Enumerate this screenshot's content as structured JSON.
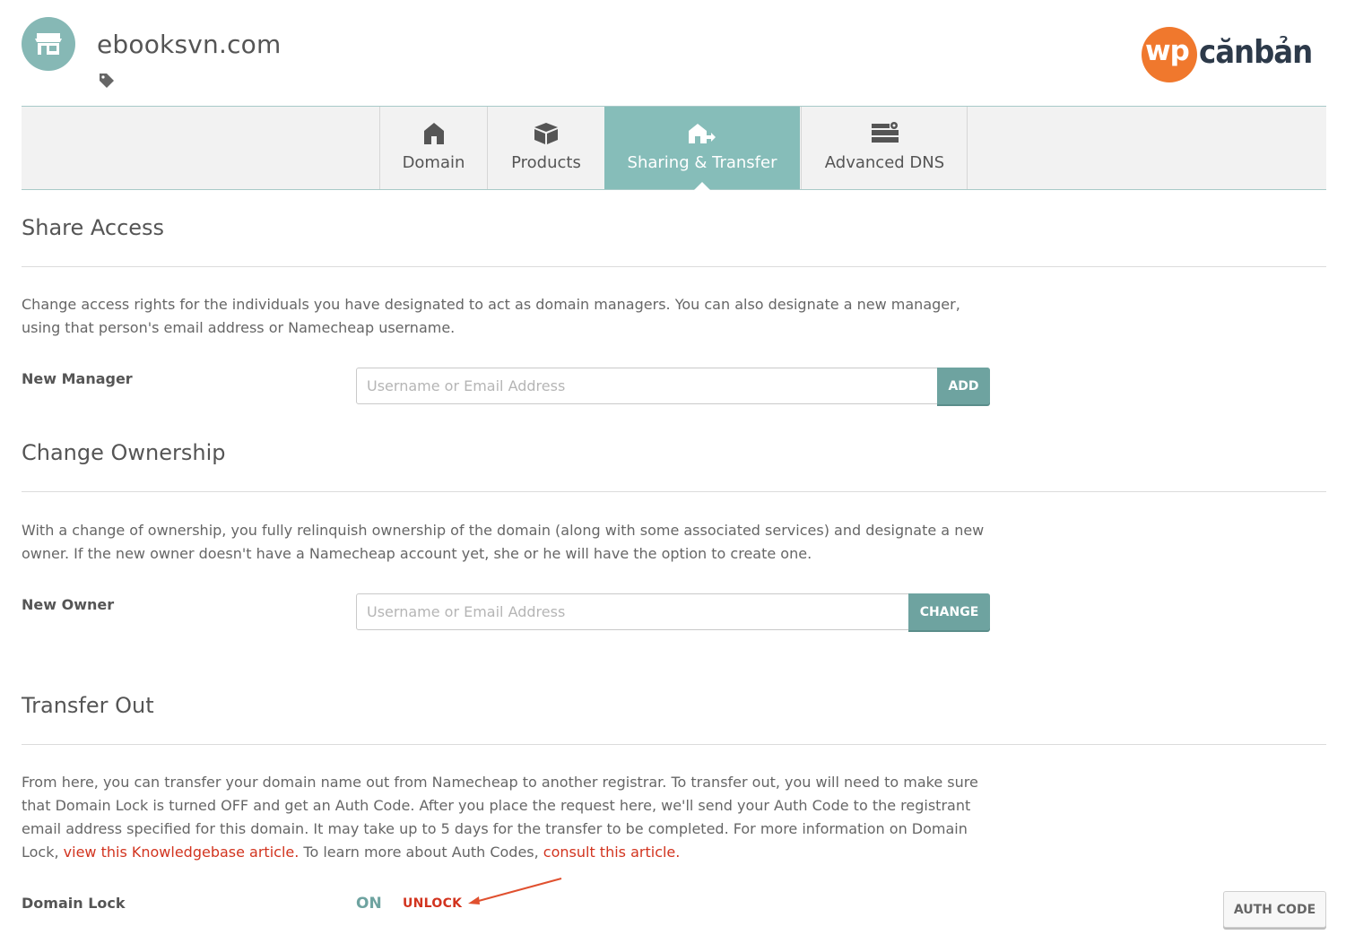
{
  "header": {
    "domain": "ebooksvn.com",
    "logo_wp": "wp",
    "logo_rest": "cănbản"
  },
  "tabs": [
    {
      "label": "Domain",
      "icon": "home-icon",
      "active": false
    },
    {
      "label": "Products",
      "icon": "box-icon",
      "active": false
    },
    {
      "label": "Sharing & Transfer",
      "icon": "house-share-icon",
      "active": true
    },
    {
      "label": "Advanced DNS",
      "icon": "server-icon",
      "active": false
    }
  ],
  "share_access": {
    "title": "Share Access",
    "description": "Change access rights for the individuals you have designated to act as domain managers. You can also designate a new manager, using that person's email address or Namecheap username.",
    "field_label": "New Manager",
    "placeholder": "Username or Email Address",
    "button": "ADD"
  },
  "change_ownership": {
    "title": "Change Ownership",
    "description": "With a change of ownership, you fully relinquish ownership of the domain (along with some associated services) and designate a new owner. If the new owner doesn't have a Namecheap account yet, she or he will have the option to create one.",
    "field_label": "New Owner",
    "placeholder": "Username or Email Address",
    "button": "CHANGE"
  },
  "transfer_out": {
    "title": "Transfer Out",
    "desc_part1": "From here, you can transfer your domain name out from Namecheap to another registrar. To transfer out, you will need to make sure that Domain Lock is turned OFF and get an Auth Code. After you place the request here, we'll send your Auth Code to the registrant email address specified for this domain. It may take up to 5 days for the transfer to be completed. For more information on Domain Lock, ",
    "link1": "view this Knowledgebase article.",
    "desc_part2": " To learn more about Auth Codes, ",
    "link2": "consult this article.",
    "field_label": "Domain Lock",
    "lock_state": "ON",
    "unlock_label": "UNLOCK",
    "auth_button": "AUTH CODE"
  },
  "colors": {
    "accent": "#86bdb9",
    "button": "#6ea3a0",
    "link": "#d2341f",
    "logo_orange": "#f0782d"
  }
}
